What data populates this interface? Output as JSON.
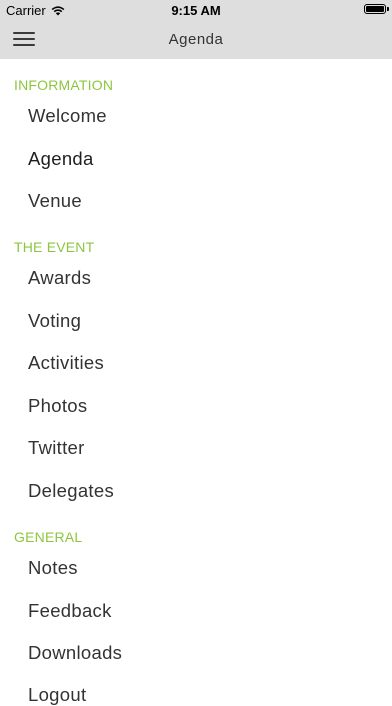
{
  "status_bar": {
    "carrier": "Carrier",
    "time": "9:15 AM",
    "battery_level": 1.0
  },
  "nav_bar": {
    "title": "Agenda",
    "menu_icon": "hamburger-menu-icon"
  },
  "sections": {
    "information": {
      "header": "INFORMATION",
      "items": [
        "Welcome",
        "Agenda",
        "Venue"
      ]
    },
    "the_event": {
      "header": "THE EVENT",
      "items": [
        "Awards",
        "Voting",
        "Activities",
        "Photos",
        "Twitter",
        "Delegates"
      ]
    },
    "general": {
      "header": "GENERAL",
      "items": [
        "Notes",
        "Feedback",
        "Downloads",
        "Logout"
      ]
    }
  },
  "colors": {
    "section_header": "#8cc63f",
    "bar_background": "#dedede",
    "item_text": "#333333"
  }
}
